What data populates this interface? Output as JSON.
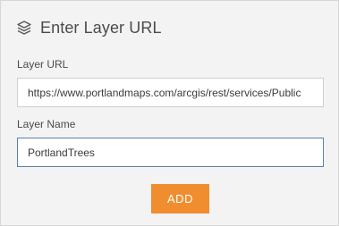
{
  "dialog": {
    "title": "Enter Layer URL",
    "icon": "layers-icon"
  },
  "form": {
    "url_label": "Layer URL",
    "url_value": "https://www.portlandmaps.com/arcgis/rest/services/Public",
    "name_label": "Layer Name",
    "name_value": "PortlandTrees"
  },
  "actions": {
    "add_label": "ADD"
  },
  "colors": {
    "accent": "#ef8d2f",
    "panel_bg": "#f3f3f3",
    "focus_border": "#5a7fa8"
  }
}
